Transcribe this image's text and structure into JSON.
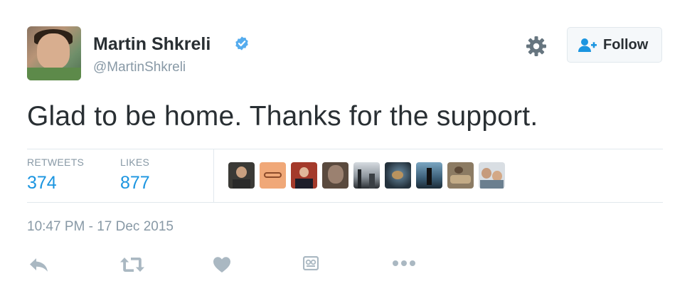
{
  "tweet": {
    "author": {
      "name": "Martin Shkreli",
      "handle": "@MartinShkreli",
      "verified": true
    },
    "follow_label": "Follow",
    "text": "Glad to be home. Thanks for the support.",
    "stats": {
      "retweets_label": "RETWEETS",
      "retweets_value": "374",
      "likes_label": "LIKES",
      "likes_value": "877"
    },
    "timestamp": "10:47 PM - 17 Dec 2015"
  },
  "liker_avatars": [
    {
      "icon": "liker-avatar-1"
    },
    {
      "icon": "liker-avatar-2"
    },
    {
      "icon": "liker-avatar-3"
    },
    {
      "icon": "liker-avatar-4"
    },
    {
      "icon": "liker-avatar-5"
    },
    {
      "icon": "liker-avatar-6"
    },
    {
      "icon": "liker-avatar-7"
    },
    {
      "icon": "liker-avatar-8"
    },
    {
      "icon": "liker-avatar-9"
    }
  ],
  "actions": [
    "reply-icon",
    "retweet-icon",
    "like-icon",
    "moments-icon",
    "more-icon"
  ],
  "colors": {
    "accent": "#1b95e0",
    "muted": "#8899a6",
    "verified": "#55acee",
    "text": "#292f33"
  }
}
